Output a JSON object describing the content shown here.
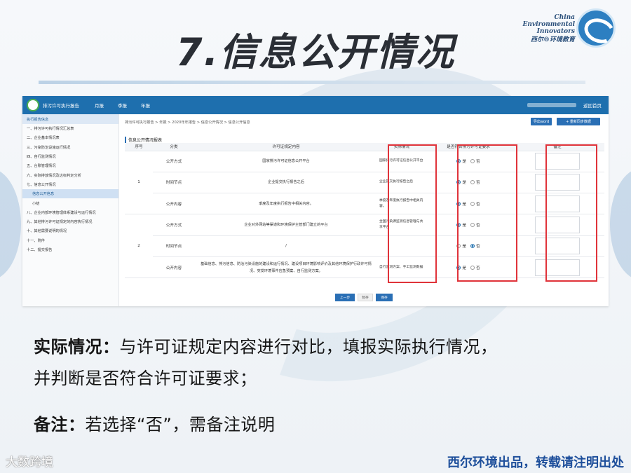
{
  "slide": {
    "title": "7.信息公开情况",
    "brand_line1": "China",
    "brand_line2": "Environmental",
    "brand_line3": "Innovators",
    "brand_cn": "西尔®环境教育",
    "footer_watermark": "大数跨境",
    "footer_right": "西尔环境出品，转载请注明出处"
  },
  "app": {
    "title": "排污许可执行报告",
    "nav": [
      "月报",
      "季报",
      "年报"
    ],
    "home": "返回首页",
    "sidebar_head": "执行报告信息",
    "sidebar": [
      "一、排污许可执行情况汇总表",
      "二、企业基本情况表",
      "三、污染防治设施运行情况",
      "四、自行监测情况",
      "五、台账管理情况",
      "六、实际排放情况及达标判定分析",
      "七、信息公开情况",
      "信息公开信息",
      "小结",
      "八、企业内部环境管理体系建设与运行情况",
      "九、其他排污许可证规定的内容执行情况",
      "十、其他需要说明的情况",
      "十一、附件",
      "十二、提交报告"
    ],
    "breadcrumb": "排污许可执行报告 > 年报 > 2020年年报告 > 信息公开情况 > 信息公开信息",
    "export_btn": "导出word",
    "sync_btn": "+ 重新同步数据",
    "section_title": "信息公开情况报表",
    "table": {
      "headers": [
        "序号",
        "分类",
        "许可证规定内容",
        "实际情况",
        "是否符合排污许可证要求",
        "备注"
      ],
      "rows": [
        {
          "no": "1",
          "cat": "公开方式",
          "content": "国家排污许可证信息公开平台",
          "actual": "国家排污许可证信息公开平台",
          "yes": true
        },
        {
          "no": "",
          "cat": "时间节点",
          "content": "企业提交执行报告之后",
          "actual": "企业提交执行报告之后",
          "yes": true
        },
        {
          "no": "",
          "cat": "公开内容",
          "content": "季度及年度执行报告中相关内容。",
          "actual": "季度及年度执行报告中相关内容。",
          "yes": true
        },
        {
          "no": "2",
          "cat": "公开方式",
          "content": "企业对外网站等渠道和环境保护主管部门建立的平台",
          "actual": "全国污染源监测信息管理与共享平台",
          "yes": true
        },
        {
          "no": "",
          "cat": "时间节点",
          "content": "/",
          "actual": "",
          "yes": false
        },
        {
          "no": "",
          "cat": "公开内容",
          "content": "基础信息、排污信息、防治污染设施的建设和运行情况、建设项目环境影响评价及其他环境保护行政许可情况、突发环境事件应急预案、自行监测方案。",
          "actual": "自行监测方案、手工监测数据",
          "yes": true
        }
      ],
      "yes_label": "是",
      "no_label": "否"
    },
    "btn_prev": "上一步",
    "btn_save": "暂存",
    "btn_next": "保存"
  },
  "text": {
    "l1_bold": "实际情况：",
    "l1_rest": "与许可证规定内容进行对比，填报实际执行情况，",
    "l2": "并判断是否符合许可证要求；",
    "l3_bold": "备注：",
    "l3_rest": "若选择“否”，需备注说明"
  },
  "colors": {
    "nav": "#1e6fae",
    "highlight": "#e0333a",
    "footer": "#1e4f9b"
  }
}
